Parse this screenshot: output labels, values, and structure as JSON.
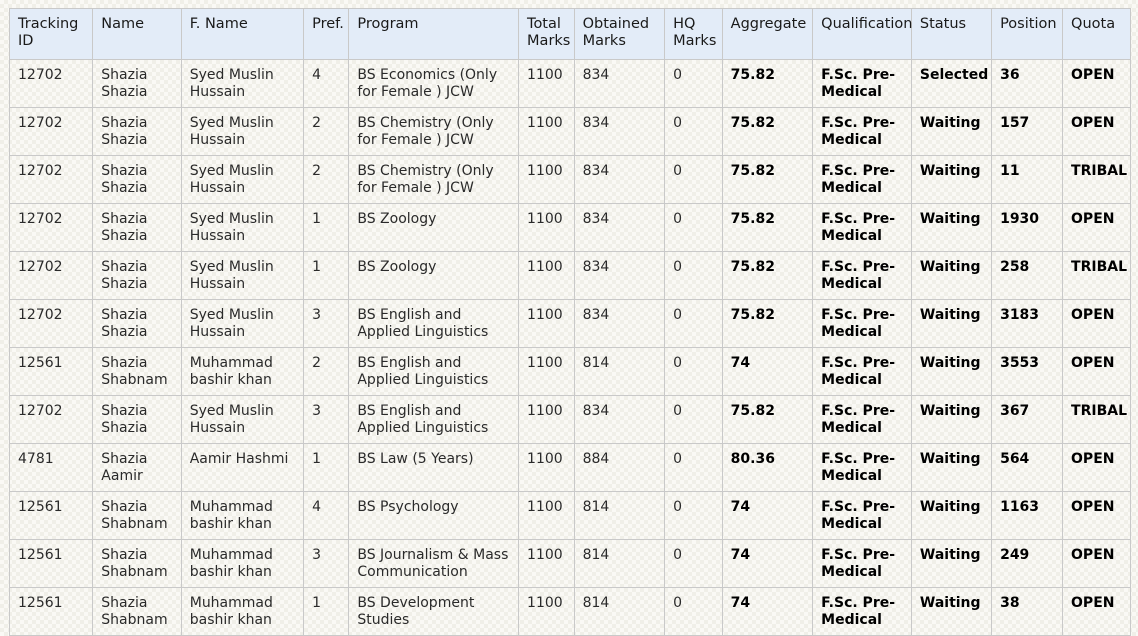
{
  "table": {
    "name": "merit-list-table",
    "columns": [
      {
        "key": "tracking_id",
        "label": "Tracking ID",
        "bold": false
      },
      {
        "key": "name",
        "label": "Name",
        "bold": false
      },
      {
        "key": "father_name",
        "label": "F. Name",
        "bold": false
      },
      {
        "key": "pref",
        "label": "Pref.",
        "bold": false
      },
      {
        "key": "program",
        "label": "Program",
        "bold": false
      },
      {
        "key": "total_marks",
        "label": "Total Marks",
        "bold": false
      },
      {
        "key": "obtained_marks",
        "label": "Obtained Marks",
        "bold": false
      },
      {
        "key": "hq_marks",
        "label": "HQ Marks",
        "bold": false
      },
      {
        "key": "aggregate",
        "label": "Aggregate",
        "bold": true
      },
      {
        "key": "qualification",
        "label": "Qualification",
        "bold": true
      },
      {
        "key": "status",
        "label": "Status",
        "bold": true
      },
      {
        "key": "position",
        "label": "Position",
        "bold": true
      },
      {
        "key": "quota",
        "label": "Quota",
        "bold": true
      }
    ],
    "rows": [
      {
        "tracking_id": "12702",
        "name": "Shazia Shazia",
        "father_name": "Syed Muslin Hussain",
        "pref": "4",
        "program": "BS Economics (Only for Female ) JCW",
        "total_marks": "1100",
        "obtained_marks": "834",
        "hq_marks": "0",
        "aggregate": "75.82",
        "qualification": "F.Sc. Pre-Medical",
        "status": "Selected",
        "position": "36",
        "quota": "OPEN"
      },
      {
        "tracking_id": "12702",
        "name": "Shazia Shazia",
        "father_name": "Syed Muslin Hussain",
        "pref": "2",
        "program": "BS Chemistry (Only for Female ) JCW",
        "total_marks": "1100",
        "obtained_marks": "834",
        "hq_marks": "0",
        "aggregate": "75.82",
        "qualification": "F.Sc. Pre-Medical",
        "status": "Waiting",
        "position": "157",
        "quota": "OPEN"
      },
      {
        "tracking_id": "12702",
        "name": "Shazia Shazia",
        "father_name": "Syed Muslin Hussain",
        "pref": "2",
        "program": "BS Chemistry (Only for Female ) JCW",
        "total_marks": "1100",
        "obtained_marks": "834",
        "hq_marks": "0",
        "aggregate": "75.82",
        "qualification": "F.Sc. Pre-Medical",
        "status": "Waiting",
        "position": "11",
        "quota": "TRIBAL"
      },
      {
        "tracking_id": "12702",
        "name": "Shazia Shazia",
        "father_name": "Syed Muslin Hussain",
        "pref": "1",
        "program": "BS Zoology",
        "total_marks": "1100",
        "obtained_marks": "834",
        "hq_marks": "0",
        "aggregate": "75.82",
        "qualification": "F.Sc. Pre-Medical",
        "status": "Waiting",
        "position": "1930",
        "quota": "OPEN"
      },
      {
        "tracking_id": "12702",
        "name": "Shazia Shazia",
        "father_name": "Syed Muslin Hussain",
        "pref": "1",
        "program": "BS Zoology",
        "total_marks": "1100",
        "obtained_marks": "834",
        "hq_marks": "0",
        "aggregate": "75.82",
        "qualification": "F.Sc. Pre-Medical",
        "status": "Waiting",
        "position": "258",
        "quota": "TRIBAL"
      },
      {
        "tracking_id": "12702",
        "name": "Shazia Shazia",
        "father_name": "Syed Muslin Hussain",
        "pref": "3",
        "program": "BS English and Applied Linguistics",
        "total_marks": "1100",
        "obtained_marks": "834",
        "hq_marks": "0",
        "aggregate": "75.82",
        "qualification": "F.Sc. Pre-Medical",
        "status": "Waiting",
        "position": "3183",
        "quota": "OPEN"
      },
      {
        "tracking_id": "12561",
        "name": "Shazia Shabnam",
        "father_name": "Muhammad bashir khan",
        "pref": "2",
        "program": "BS English and Applied Linguistics",
        "total_marks": "1100",
        "obtained_marks": "814",
        "hq_marks": "0",
        "aggregate": "74",
        "qualification": "F.Sc. Pre-Medical",
        "status": "Waiting",
        "position": "3553",
        "quota": "OPEN"
      },
      {
        "tracking_id": "12702",
        "name": "Shazia Shazia",
        "father_name": "Syed Muslin Hussain",
        "pref": "3",
        "program": "BS English and Applied Linguistics",
        "total_marks": "1100",
        "obtained_marks": "834",
        "hq_marks": "0",
        "aggregate": "75.82",
        "qualification": "F.Sc. Pre-Medical",
        "status": "Waiting",
        "position": "367",
        "quota": "TRIBAL"
      },
      {
        "tracking_id": "4781",
        "name": "Shazia Aamir",
        "father_name": "Aamir Hashmi",
        "pref": "1",
        "program": "BS Law (5 Years)",
        "total_marks": "1100",
        "obtained_marks": "884",
        "hq_marks": "0",
        "aggregate": "80.36",
        "qualification": "F.Sc. Pre-Medical",
        "status": "Waiting",
        "position": "564",
        "quota": "OPEN"
      },
      {
        "tracking_id": "12561",
        "name": "Shazia Shabnam",
        "father_name": "Muhammad bashir khan",
        "pref": "4",
        "program": "BS Psychology",
        "total_marks": "1100",
        "obtained_marks": "814",
        "hq_marks": "0",
        "aggregate": "74",
        "qualification": "F.Sc. Pre-Medical",
        "status": "Waiting",
        "position": "1163",
        "quota": "OPEN"
      },
      {
        "tracking_id": "12561",
        "name": "Shazia Shabnam",
        "father_name": "Muhammad bashir khan",
        "pref": "3",
        "program": "BS Journalism & Mass Communication",
        "total_marks": "1100",
        "obtained_marks": "814",
        "hq_marks": "0",
        "aggregate": "74",
        "qualification": "F.Sc. Pre-Medical",
        "status": "Waiting",
        "position": "249",
        "quota": "OPEN"
      },
      {
        "tracking_id": "12561",
        "name": "Shazia Shabnam",
        "father_name": "Muhammad bashir khan",
        "pref": "1",
        "program": "BS Development Studies",
        "total_marks": "1100",
        "obtained_marks": "814",
        "hq_marks": "0",
        "aggregate": "74",
        "qualification": "F.Sc. Pre-Medical",
        "status": "Waiting",
        "position": "38",
        "quota": "OPEN"
      }
    ]
  },
  "colors": {
    "header_bg": "#e3ecf8",
    "border": "#c9c9c9",
    "page_bg": "#faf9f5",
    "text": "#2a2a2a",
    "text_bold": "#000000"
  }
}
